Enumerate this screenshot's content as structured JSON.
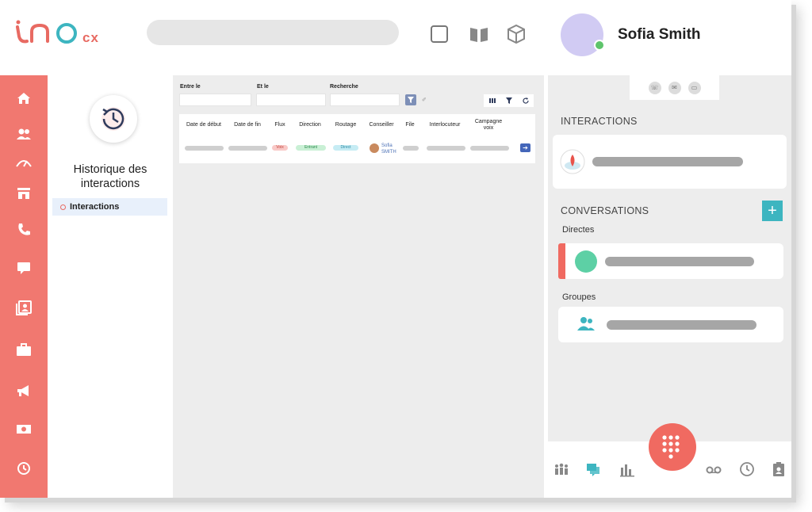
{
  "brand": {
    "logo_suffix": "cx",
    "accent_color": "#f17870",
    "teal_color": "#3db5c0"
  },
  "header": {
    "user_name": "Sofia Smith"
  },
  "sidebar": {
    "items": [
      "home-icon",
      "users-icon",
      "dashboard-icon",
      "store-icon",
      "phone-icon",
      "chat-icon",
      "contacts-icon",
      "briefcase-icon",
      "megaphone-icon",
      "money-icon",
      "history-icon"
    ]
  },
  "subpanel": {
    "title_line1": "Historique des",
    "title_line2": "interactions",
    "nav_item": "Interactions"
  },
  "filters": {
    "between_label": "Entre le",
    "and_label": "Et le",
    "search_label": "Recherche"
  },
  "table": {
    "headers": [
      "Date de début",
      "Date de fin",
      "Flux",
      "Direction",
      "Routage",
      "Conseiller",
      "File",
      "Interlocuteur",
      "Campagne voix"
    ],
    "row": {
      "flux": "Voix",
      "direction": "Entrant",
      "routage": "Direct",
      "agent_first": "Sofia",
      "agent_last": "SMITH"
    }
  },
  "right_panel": {
    "interactions_title": "INTERACTIONS",
    "conversations_title": "CONVERSATIONS",
    "directes_label": "Directes",
    "groupes_label": "Groupes",
    "plus_label": "+"
  }
}
